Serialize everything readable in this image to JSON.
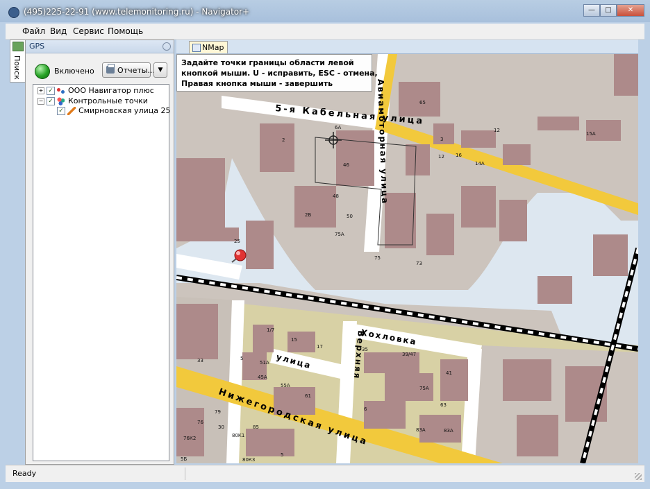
{
  "window": {
    "title": "(495)225-22-91  (www.telemonitoring.ru) - Navigator+",
    "buttons": {
      "minimize": "—",
      "maximize": "□",
      "close": "✕"
    }
  },
  "menu": [
    "Файл",
    "Вид",
    "Сервис",
    "Помощь"
  ],
  "sidebar_tab": "Поиск",
  "gps_panel": {
    "title": "GPS",
    "status": "Включено",
    "reports_button": "Отчеты...",
    "tree": [
      {
        "label": "ООО Навигатор плюс",
        "checked": true,
        "expanded": false
      },
      {
        "label": "Контрольные точки",
        "checked": true,
        "expanded": true
      },
      {
        "label": "Смирновская улица 25",
        "checked": true
      }
    ]
  },
  "document_tab": "NMap",
  "map": {
    "hint_lines": [
      "Задайте точки границы области левой",
      "кнопкой мыши. U - исправить, ESC - отмена,",
      "Правая кнопка мыши - завершить"
    ],
    "streets": {
      "kabelnaya": "5-я Кабельная улица",
      "aviamotornaya": "Авиамоторная улица",
      "verkhnyaya": "Верхняя",
      "ulitsa": "улица",
      "khokhlovka": "Хохловка",
      "nizhegorodskaya": "Нижегородская улица"
    },
    "house_numbers": [
      "65",
      "6А",
      "2",
      "12",
      "3",
      "12",
      "16",
      "15А",
      "14А",
      "46",
      "48",
      "2Б",
      "50",
      "75А",
      "25",
      "75",
      "73",
      "1/7",
      "15",
      "17",
      "35",
      "39/47",
      "33",
      "5",
      "51А",
      "45А",
      "55А",
      "61",
      "41",
      "75А",
      "63",
      "6",
      "30",
      "79",
      "76",
      "85",
      "83А",
      "83А",
      "76К2",
      "80К1",
      "5Б",
      "80К3",
      "5"
    ],
    "colors": {
      "road_yellow": "#f2c93c",
      "river": "#dde7f0",
      "building": "#ad8a8a",
      "block_green": "#d8d1a5"
    }
  },
  "statusbar": {
    "text": "Ready"
  }
}
